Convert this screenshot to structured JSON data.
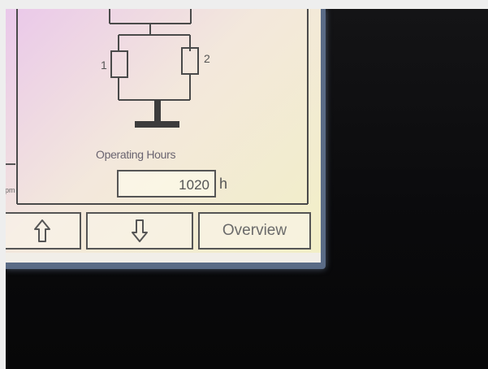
{
  "diagram": {
    "motor_1_label": "1",
    "motor_2_label": "2"
  },
  "left_panel": {
    "unit_fragment": "pm"
  },
  "operating_hours": {
    "label": "Operating Hours",
    "value": "1020",
    "unit": "h"
  },
  "buttons": {
    "up_icon": "arrow-up-outline-icon",
    "down_icon": "arrow-down-outline-icon",
    "overview_label": "Overview"
  },
  "colors": {
    "panel_bg_light": "#f2efc6",
    "panel_bg_pink": "#eac8ea",
    "line": "#4a4a4a",
    "text": "#6a6470"
  }
}
